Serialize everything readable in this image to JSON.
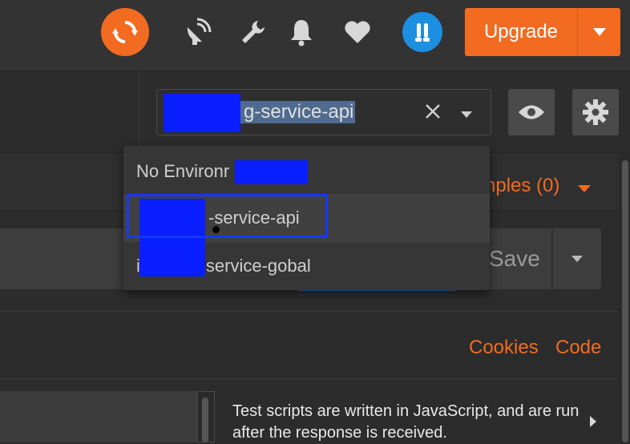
{
  "topbar": {
    "sync_icon": "sync-icon",
    "icons": [
      "satellite-icon",
      "wrench-icon",
      "bell-icon",
      "heart-icon"
    ],
    "avatar_icon": "user-avatar",
    "upgrade_label": "Upgrade",
    "accent": "#f26b21"
  },
  "environment": {
    "selected_value": "g-service-api",
    "clear_icon": "close-icon",
    "caret_icon": "chevron-down-icon",
    "eye_icon": "eye-icon",
    "settings_icon": "gear-icon",
    "options": [
      {
        "label": "No Environr"
      },
      {
        "label": "-service-api"
      },
      {
        "label": "service-gobal"
      }
    ],
    "option_prefix_3": "i"
  },
  "tabs": {
    "examples_label": "nples (0)"
  },
  "request": {
    "save_label": "Save"
  },
  "links": {
    "cookies": "Cookies",
    "code": "Code"
  },
  "tests": {
    "description": "Test scripts are written in JavaScript, and are run after the response is received."
  }
}
